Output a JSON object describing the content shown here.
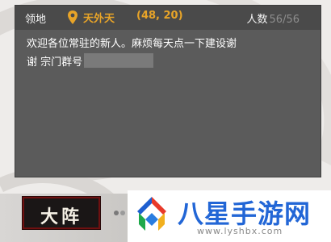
{
  "header": {
    "territory_label": "领地",
    "territory_icon": "location-pin-icon",
    "territory_name": "天外天",
    "territory_coords": "(48, 20)",
    "members_label": "人数",
    "members_count": "56/56"
  },
  "announcement": {
    "line1": "欢迎各位常驻的新人。麻烦每天点一下建设谢",
    "line2": "谢 宗门群号"
  },
  "bottom": {
    "formation_tab_label": "大阵"
  },
  "watermark": {
    "title": "八星手游网",
    "url": "www.lyshbx.com"
  },
  "colors": {
    "accent_orange": "#e8a428",
    "panel_bg": "#5b5b5b",
    "tab_bg": "#1a1616",
    "watermark_blue": "#2266d6"
  }
}
